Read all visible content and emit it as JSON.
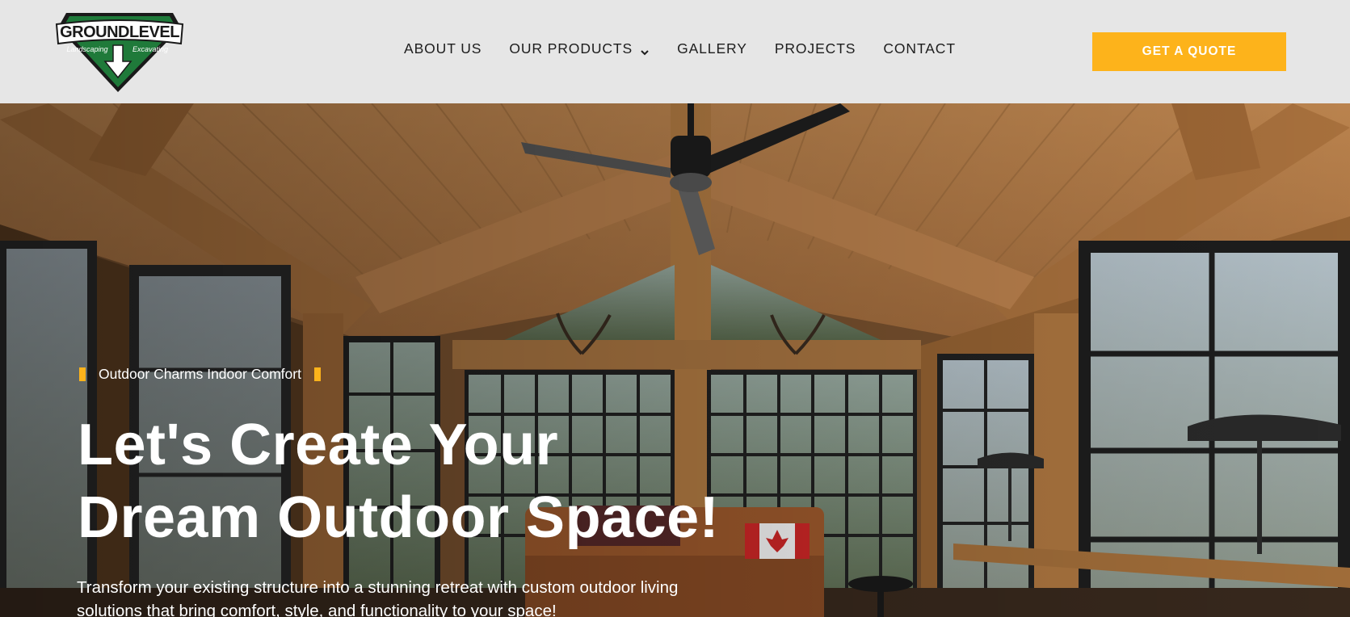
{
  "header": {
    "logo": {
      "brand": "GROUNDLEVEL",
      "left_word": "Landscaping",
      "right_word": "Excavating",
      "colors": {
        "green": "#1f7a3a",
        "dark": "#1a1a1a",
        "white": "#ffffff"
      }
    },
    "nav": [
      {
        "label": "ABOUT US"
      },
      {
        "label": "OUR PRODUCTS",
        "icon": "chevron-down-icon"
      },
      {
        "label": "GALLERY"
      },
      {
        "label": "PROJECTS"
      },
      {
        "label": "CONTACT"
      }
    ],
    "cta": {
      "label": "GET A QUOTE",
      "color": "#fdb31b"
    }
  },
  "hero": {
    "eyebrow": "Outdoor Charms Indoor Comfort",
    "headline_line1": "Let's Create Your",
    "headline_line2": "Dream Outdoor Space!",
    "subtext": "Transform your existing structure into a stunning retreat with custom outdoor living solutions that bring comfort, style, and functionality to your space!",
    "accent_color": "#fdb31b"
  }
}
